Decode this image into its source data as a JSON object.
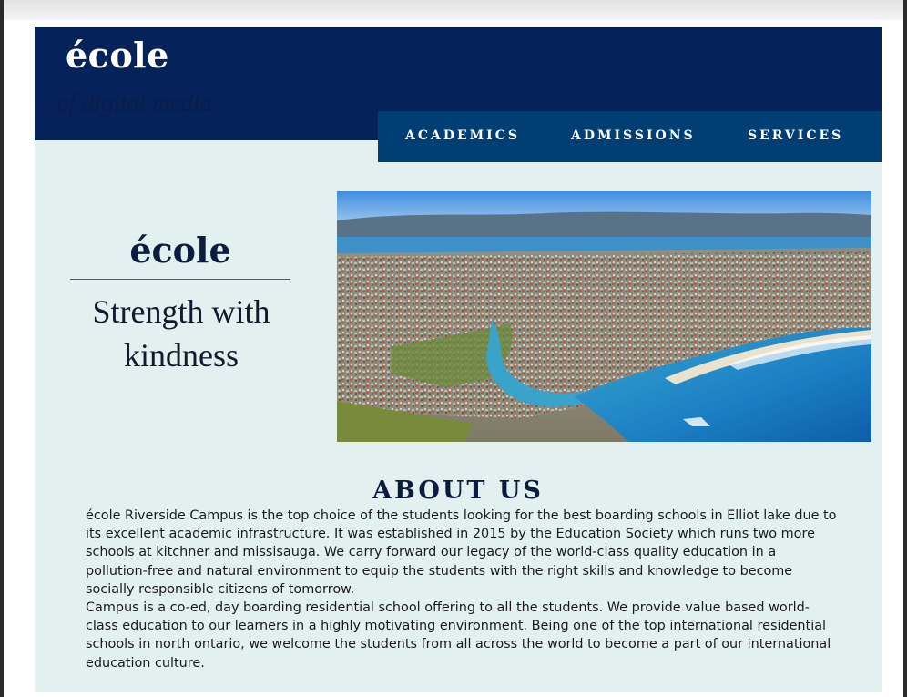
{
  "header": {
    "logo": "école",
    "tagline": "...of digital media"
  },
  "nav": {
    "items": [
      "ACADEMICS",
      "ADMISSIONS",
      "SERVICES"
    ]
  },
  "hero": {
    "brand": "école",
    "slogan": "Strength with kindness",
    "image_icon": "aerial-coastal-town-photo"
  },
  "about": {
    "title": "ABOUT US",
    "paragraphs": [
      "école Riverside Campus is the top choice of the students looking for the best boarding schools in Elliot lake due to its excellent academic infrastructure. It was established in 2015 by the Education Society which runs two more schools at kitchner and missisauga. We carry forward our legacy of the world-class quality education in a pollution-free and natural environment to equip the students with the right skills and knowledge to become socially responsible citizens of tomorrow.",
      "Campus is a co-ed, day boarding residential school offering to all the students. We provide value based world-class education to our learners in a highly motivating environment. Being one of the top international residential schools in north ontario, we welcome the students from all across the world to become a part of our international education culture."
    ]
  },
  "colors": {
    "header_bg": "#06225a",
    "nav_bg": "#003e73",
    "page_bg": "#e2f1f0",
    "text_dark": "#0b1c3f"
  }
}
